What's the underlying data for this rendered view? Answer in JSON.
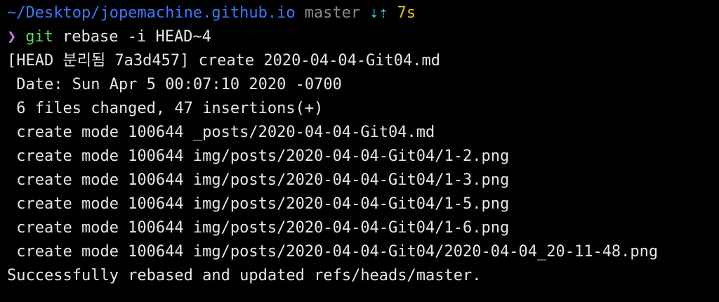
{
  "colors": {
    "background": "#000000",
    "foreground": "#e6e6e6",
    "path": "#3b78ff",
    "branch": "#8a8a8a",
    "arrows": "#33c6d6",
    "elapsed": "#e5c31c",
    "prompt_char": "#c678dd",
    "command": "#5fd75f"
  },
  "prompt": {
    "path": "~/Desktop/jopemachine.github.io",
    "branch": "master",
    "sync_arrows": "⇣⇡",
    "elapsed": "7s",
    "prompt_char": "❯"
  },
  "command": {
    "name": "git",
    "args": "rebase -i HEAD~4"
  },
  "output": [
    "[HEAD 분리됨 7a3d457] create 2020-04-04-Git04.md",
    " Date: Sun Apr 5 00:07:10 2020 -0700",
    " 6 files changed, 47 insertions(+)",
    " create mode 100644 _posts/2020-04-04-Git04.md",
    " create mode 100644 img/posts/2020-04-04-Git04/1-2.png",
    " create mode 100644 img/posts/2020-04-04-Git04/1-3.png",
    " create mode 100644 img/posts/2020-04-04-Git04/1-5.png",
    " create mode 100644 img/posts/2020-04-04-Git04/1-6.png",
    " create mode 100644 img/posts/2020-04-04-Git04/2020-04-04_20-11-48.png",
    "Successfully rebased and updated refs/heads/master."
  ]
}
